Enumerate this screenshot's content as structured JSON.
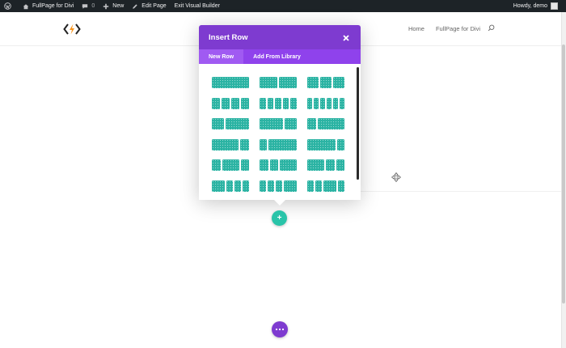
{
  "adminbar": {
    "site_name": "FullPage for Divi",
    "comments_count": "0",
    "new_label": "New",
    "edit_page_label": "Edit Page",
    "exit_vb_label": "Exit Visual Builder",
    "howdy": "Howdy, demo"
  },
  "nav": {
    "items": [
      "Home",
      "FullPage for Divi"
    ]
  },
  "modal": {
    "title": "Insert Row",
    "tabs": [
      "New Row",
      "Add From Library"
    ],
    "active_tab": "New Row",
    "layouts": [
      [
        [
          1
        ],
        [
          1,
          1
        ],
        [
          1,
          1,
          1
        ]
      ],
      [
        [
          1,
          1,
          1,
          1
        ],
        [
          1,
          1,
          1,
          1,
          1
        ],
        [
          1,
          1,
          1,
          1,
          1,
          1
        ]
      ],
      [
        [
          1,
          2
        ],
        [
          2,
          1
        ],
        [
          1,
          3
        ]
      ],
      [
        [
          3,
          1
        ],
        [
          1,
          4
        ],
        [
          4,
          1
        ]
      ],
      [
        [
          1,
          2,
          1
        ],
        [
          1,
          1,
          2
        ],
        [
          2,
          1,
          1
        ]
      ],
      [
        [
          2,
          1,
          1,
          1
        ],
        [
          1,
          1,
          1,
          2
        ],
        [
          1,
          1,
          2,
          1
        ]
      ]
    ]
  },
  "add_button_label": "+",
  "colors": {
    "admin_bar": "#1d2327",
    "modal_header": "#7e3bd0",
    "modal_tabs": "#8f42ec",
    "layout_column": "#2bb3a3",
    "add_button": "#29c4a9",
    "menu_button": "#7e3bd0"
  }
}
